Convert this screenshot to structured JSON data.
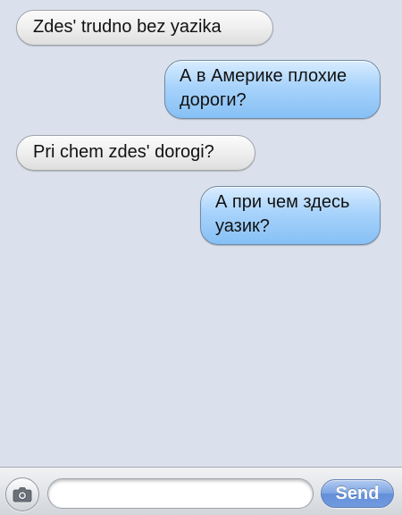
{
  "messages": [
    {
      "direction": "incoming",
      "text": "Zdes' trudno bez yazika"
    },
    {
      "direction": "outgoing",
      "text": "А в Америке плохие\nдороги?"
    },
    {
      "direction": "incoming",
      "text": "Pri chem zdes' dorogi?"
    },
    {
      "direction": "outgoing",
      "text": "А при чем здесь\nуазик?"
    }
  ],
  "composer": {
    "camera_icon": "camera-icon",
    "input_value": "",
    "input_placeholder": "",
    "send_label": "Send"
  },
  "colors": {
    "background": "#dbe1ec",
    "incoming_bubble": "#f0f0f0",
    "outgoing_bubble": "#a8d3fb",
    "send_button": "#5f90e0"
  }
}
